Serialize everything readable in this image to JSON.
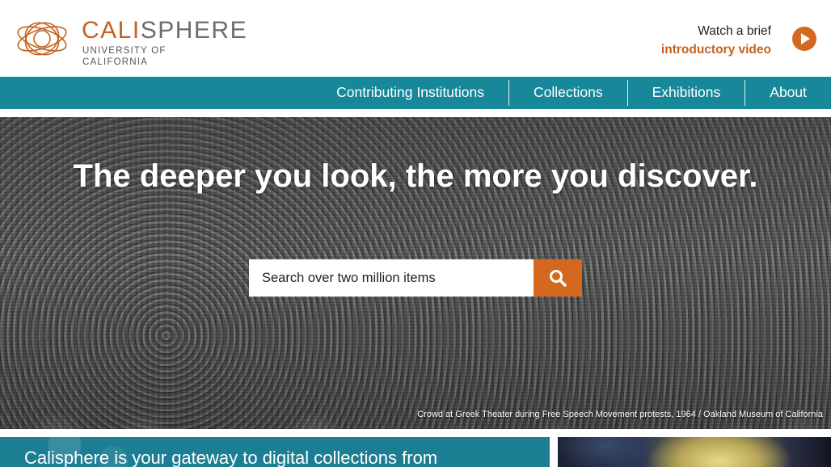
{
  "header": {
    "logo": {
      "word_accent": "CALI",
      "word_rest": "SPHERE",
      "subtitle": "UNIVERSITY OF CALIFORNIA",
      "icon": "calisphere-logo-icon"
    },
    "video_promo": {
      "line1": "Watch a brief",
      "line2": "introductory video",
      "icon": "play-icon"
    }
  },
  "nav": {
    "items": [
      {
        "label": "Contributing Institutions"
      },
      {
        "label": "Collections"
      },
      {
        "label": "Exhibitions"
      },
      {
        "label": "About"
      }
    ]
  },
  "hero": {
    "headline": "The deeper you look, the more you discover.",
    "search": {
      "placeholder": "Search over two million items",
      "button_icon": "search-icon"
    },
    "caption": "Crowd at Greek Theater during Free Speech Movement protests, 1964 / Oakland Museum of California"
  },
  "gateway": {
    "text": "Calisphere is your gateway to digital collections from"
  },
  "colors": {
    "accent_orange": "#d4681f",
    "nav_teal": "#17889a",
    "gateway_teal": "#1c7e93"
  }
}
